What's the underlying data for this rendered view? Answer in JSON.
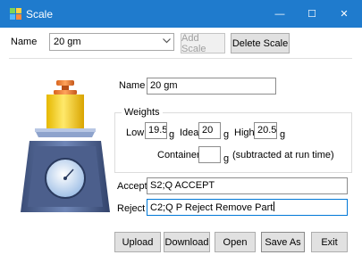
{
  "window": {
    "title": "Scale",
    "minimize_glyph": "—",
    "maximize_glyph": "☐",
    "close_glyph": "✕"
  },
  "colors": {
    "titlebar": "#1f7bcd",
    "window_background": "#ffffff",
    "active_field_border": "#0078d7"
  },
  "selector": {
    "label": "Name",
    "value": "20 gm",
    "add_label": "Add Scale",
    "delete_label": "Delete Scale"
  },
  "form": {
    "name_label": "Name",
    "name_value": "20 gm",
    "weights_title": "Weights",
    "low_label": "Low",
    "low_value": "19.5",
    "ideal_label": "Ideal",
    "ideal_value": "20",
    "high_label": "High",
    "high_value": "20.5",
    "unit": "g",
    "container_label": "Container",
    "container_value": "",
    "container_note": "(subtracted at run time)",
    "accept_label": "Accept",
    "accept_value": "S2;Q ACCEPT",
    "reject_label": "Reject",
    "reject_value": "C2;Q P Reject Remove Part"
  },
  "buttons": {
    "upload": "Upload",
    "download": "Download",
    "open": "Open",
    "save_as": "Save As",
    "exit": "Exit"
  },
  "icons": {
    "app": "scale-app-icon",
    "dropdown": "chevron-down-icon",
    "illustration": "weighing-scale-illustration"
  }
}
